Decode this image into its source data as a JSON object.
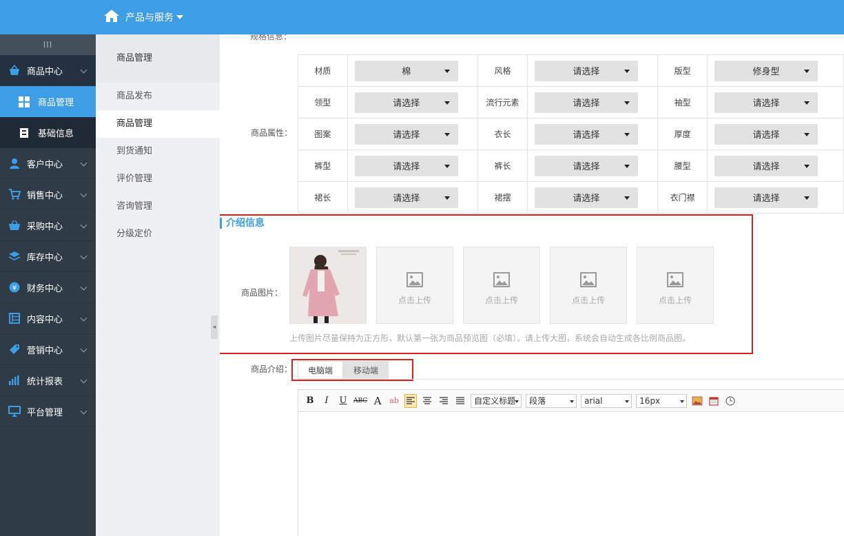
{
  "header": {
    "menu_label": "产品与服务"
  },
  "sidebar": {
    "handle": "III",
    "items": [
      {
        "label": "商品中心",
        "icon": "basket-icon"
      },
      {
        "label": "客户中心",
        "icon": "user-icon"
      },
      {
        "label": "销售中心",
        "icon": "cart-icon"
      },
      {
        "label": "采购中心",
        "icon": "purchase-basket-icon"
      },
      {
        "label": "库存中心",
        "icon": "layers-icon"
      },
      {
        "label": "财务中心",
        "icon": "yen-icon"
      },
      {
        "label": "内容中心",
        "icon": "list-icon"
      },
      {
        "label": "营销中心",
        "icon": "tag-icon"
      },
      {
        "label": "统计报表",
        "icon": "bar-chart-icon"
      },
      {
        "label": "平台管理",
        "icon": "monitor-icon"
      }
    ],
    "subitems": [
      {
        "label": "商品管理",
        "icon": "grid-icon",
        "active": true
      },
      {
        "label": "基础信息",
        "icon": "document-icon",
        "active": false
      }
    ]
  },
  "subnav": {
    "title": "商品管理",
    "links": [
      "商品发布",
      "商品管理",
      "到货通知",
      "评价管理",
      "咨询管理",
      "分级定价"
    ]
  },
  "form": {
    "cut_label": "规格信息：",
    "attr_label": "商品属性：",
    "attributes": [
      [
        {
          "label": "材质",
          "value": "棉"
        },
        {
          "label": "风格",
          "value": "请选择"
        },
        {
          "label": "版型",
          "value": "修身型"
        }
      ],
      [
        {
          "label": "领型",
          "value": "请选择"
        },
        {
          "label": "流行元素",
          "value": "请选择"
        },
        {
          "label": "袖型",
          "value": "请选择"
        }
      ],
      [
        {
          "label": "图案",
          "value": "请选择"
        },
        {
          "label": "衣长",
          "value": "请选择"
        },
        {
          "label": "厚度",
          "value": "请选择"
        }
      ],
      [
        {
          "label": "裤型",
          "value": "请选择"
        },
        {
          "label": "裤长",
          "value": "请选择"
        },
        {
          "label": "腰型",
          "value": "请选择"
        }
      ],
      [
        {
          "label": "裙长",
          "value": "请选择"
        },
        {
          "label": "裙摆",
          "value": "请选择"
        },
        {
          "label": "衣门襟",
          "value": "请选择"
        }
      ]
    ],
    "section_title": "介绍信息",
    "image_label": "商品图片：",
    "upload_text": "点击上传",
    "upload_hint": "上传图片尽量保持为正方形，默认第一张为商品预览图（必填）。请上传大图，系统会自动生成各比例商品图。",
    "intro_label": "商品介绍：",
    "tabs": [
      {
        "label": "电脑端",
        "active": false
      },
      {
        "label": "移动端",
        "active": true
      }
    ]
  },
  "editor": {
    "buttons": [
      "B",
      "I",
      "U",
      "ABC",
      "A",
      "ab"
    ],
    "heading_select": "自定义标题",
    "paragraph_select": "段落",
    "font_select": "arial",
    "size_select": "16px"
  },
  "colors": {
    "primary": "#3d9ee5",
    "sidebar": "#2f3b47",
    "highlight": "#e02020"
  }
}
